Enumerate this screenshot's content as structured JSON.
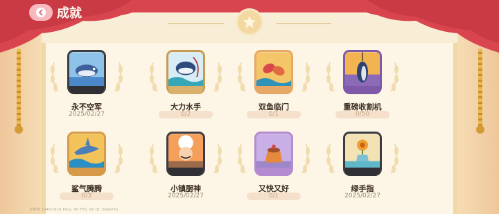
{
  "header": {
    "title": "成就"
  },
  "colors": {
    "curtain": "#d8454e",
    "panel": "#fdf6e6",
    "accent": "#f3d9a1"
  },
  "achievements": [
    {
      "name": "永不空军",
      "sub": "2025/02/27",
      "icon": "tuna-on-hook-icon",
      "kind": "date"
    },
    {
      "name": "大力水手",
      "sub": "0/2",
      "icon": "tuna-wave-icon",
      "kind": "progress"
    },
    {
      "name": "双鱼临门",
      "sub": "0/1",
      "icon": "twin-fish-icon",
      "kind": "progress"
    },
    {
      "name": "重磅收割机",
      "sub": "0/50",
      "icon": "hanging-tuna-icon",
      "kind": "progress"
    },
    {
      "name": "鲨气腾腾",
      "sub": "0/3",
      "icon": "shark-icon",
      "kind": "progress"
    },
    {
      "name": "小镇厨神",
      "sub": "2025/02/27",
      "icon": "chef-icon",
      "kind": "date"
    },
    {
      "name": "又快又好",
      "sub": "0/1",
      "icon": "pudding-icon",
      "kind": "progress"
    },
    {
      "name": "绿手指",
      "sub": "2025/02/27",
      "icon": "flower-pot-icon",
      "kind": "date"
    }
  ],
  "footer": {
    "system_text": "分辨率 1440×618  Ping: 45 FPS: 60  ID: 8a0ef3b"
  }
}
